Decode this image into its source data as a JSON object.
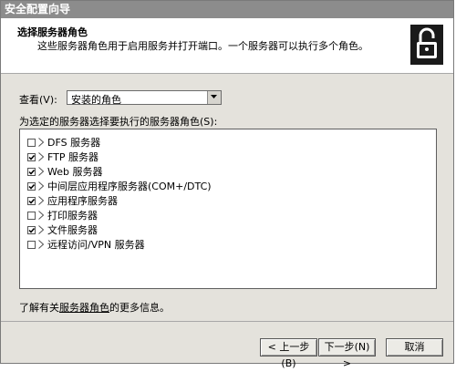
{
  "window": {
    "title": "安全配置向导"
  },
  "header": {
    "title": "选择服务器角色",
    "subtitle": "这些服务器角色用于启用服务并打开端口。一个服务器可以执行多个角色。",
    "icon": "padlock-icon"
  },
  "view": {
    "label": "查看(V):",
    "selected": "安装的角色"
  },
  "list": {
    "label": "为选定的服务器选择要执行的服务器角色(S):",
    "roles": [
      {
        "label": "DFS 服务器",
        "checked": false
      },
      {
        "label": "FTP 服务器",
        "checked": true
      },
      {
        "label": "Web 服务器",
        "checked": true
      },
      {
        "label": "中间层应用程序服务器(COM+/DTC)",
        "checked": true
      },
      {
        "label": "应用程序服务器",
        "checked": true
      },
      {
        "label": "打印服务器",
        "checked": false
      },
      {
        "label": "文件服务器",
        "checked": true
      },
      {
        "label": "远程访问/VPN 服务器",
        "checked": false
      }
    ]
  },
  "info": {
    "prefix": "了解有关",
    "link": "服务器角色",
    "suffix": "的更多信息。"
  },
  "buttons": {
    "back": "< 上一步(B)",
    "next": "下一步(N) >",
    "cancel": "取消"
  }
}
